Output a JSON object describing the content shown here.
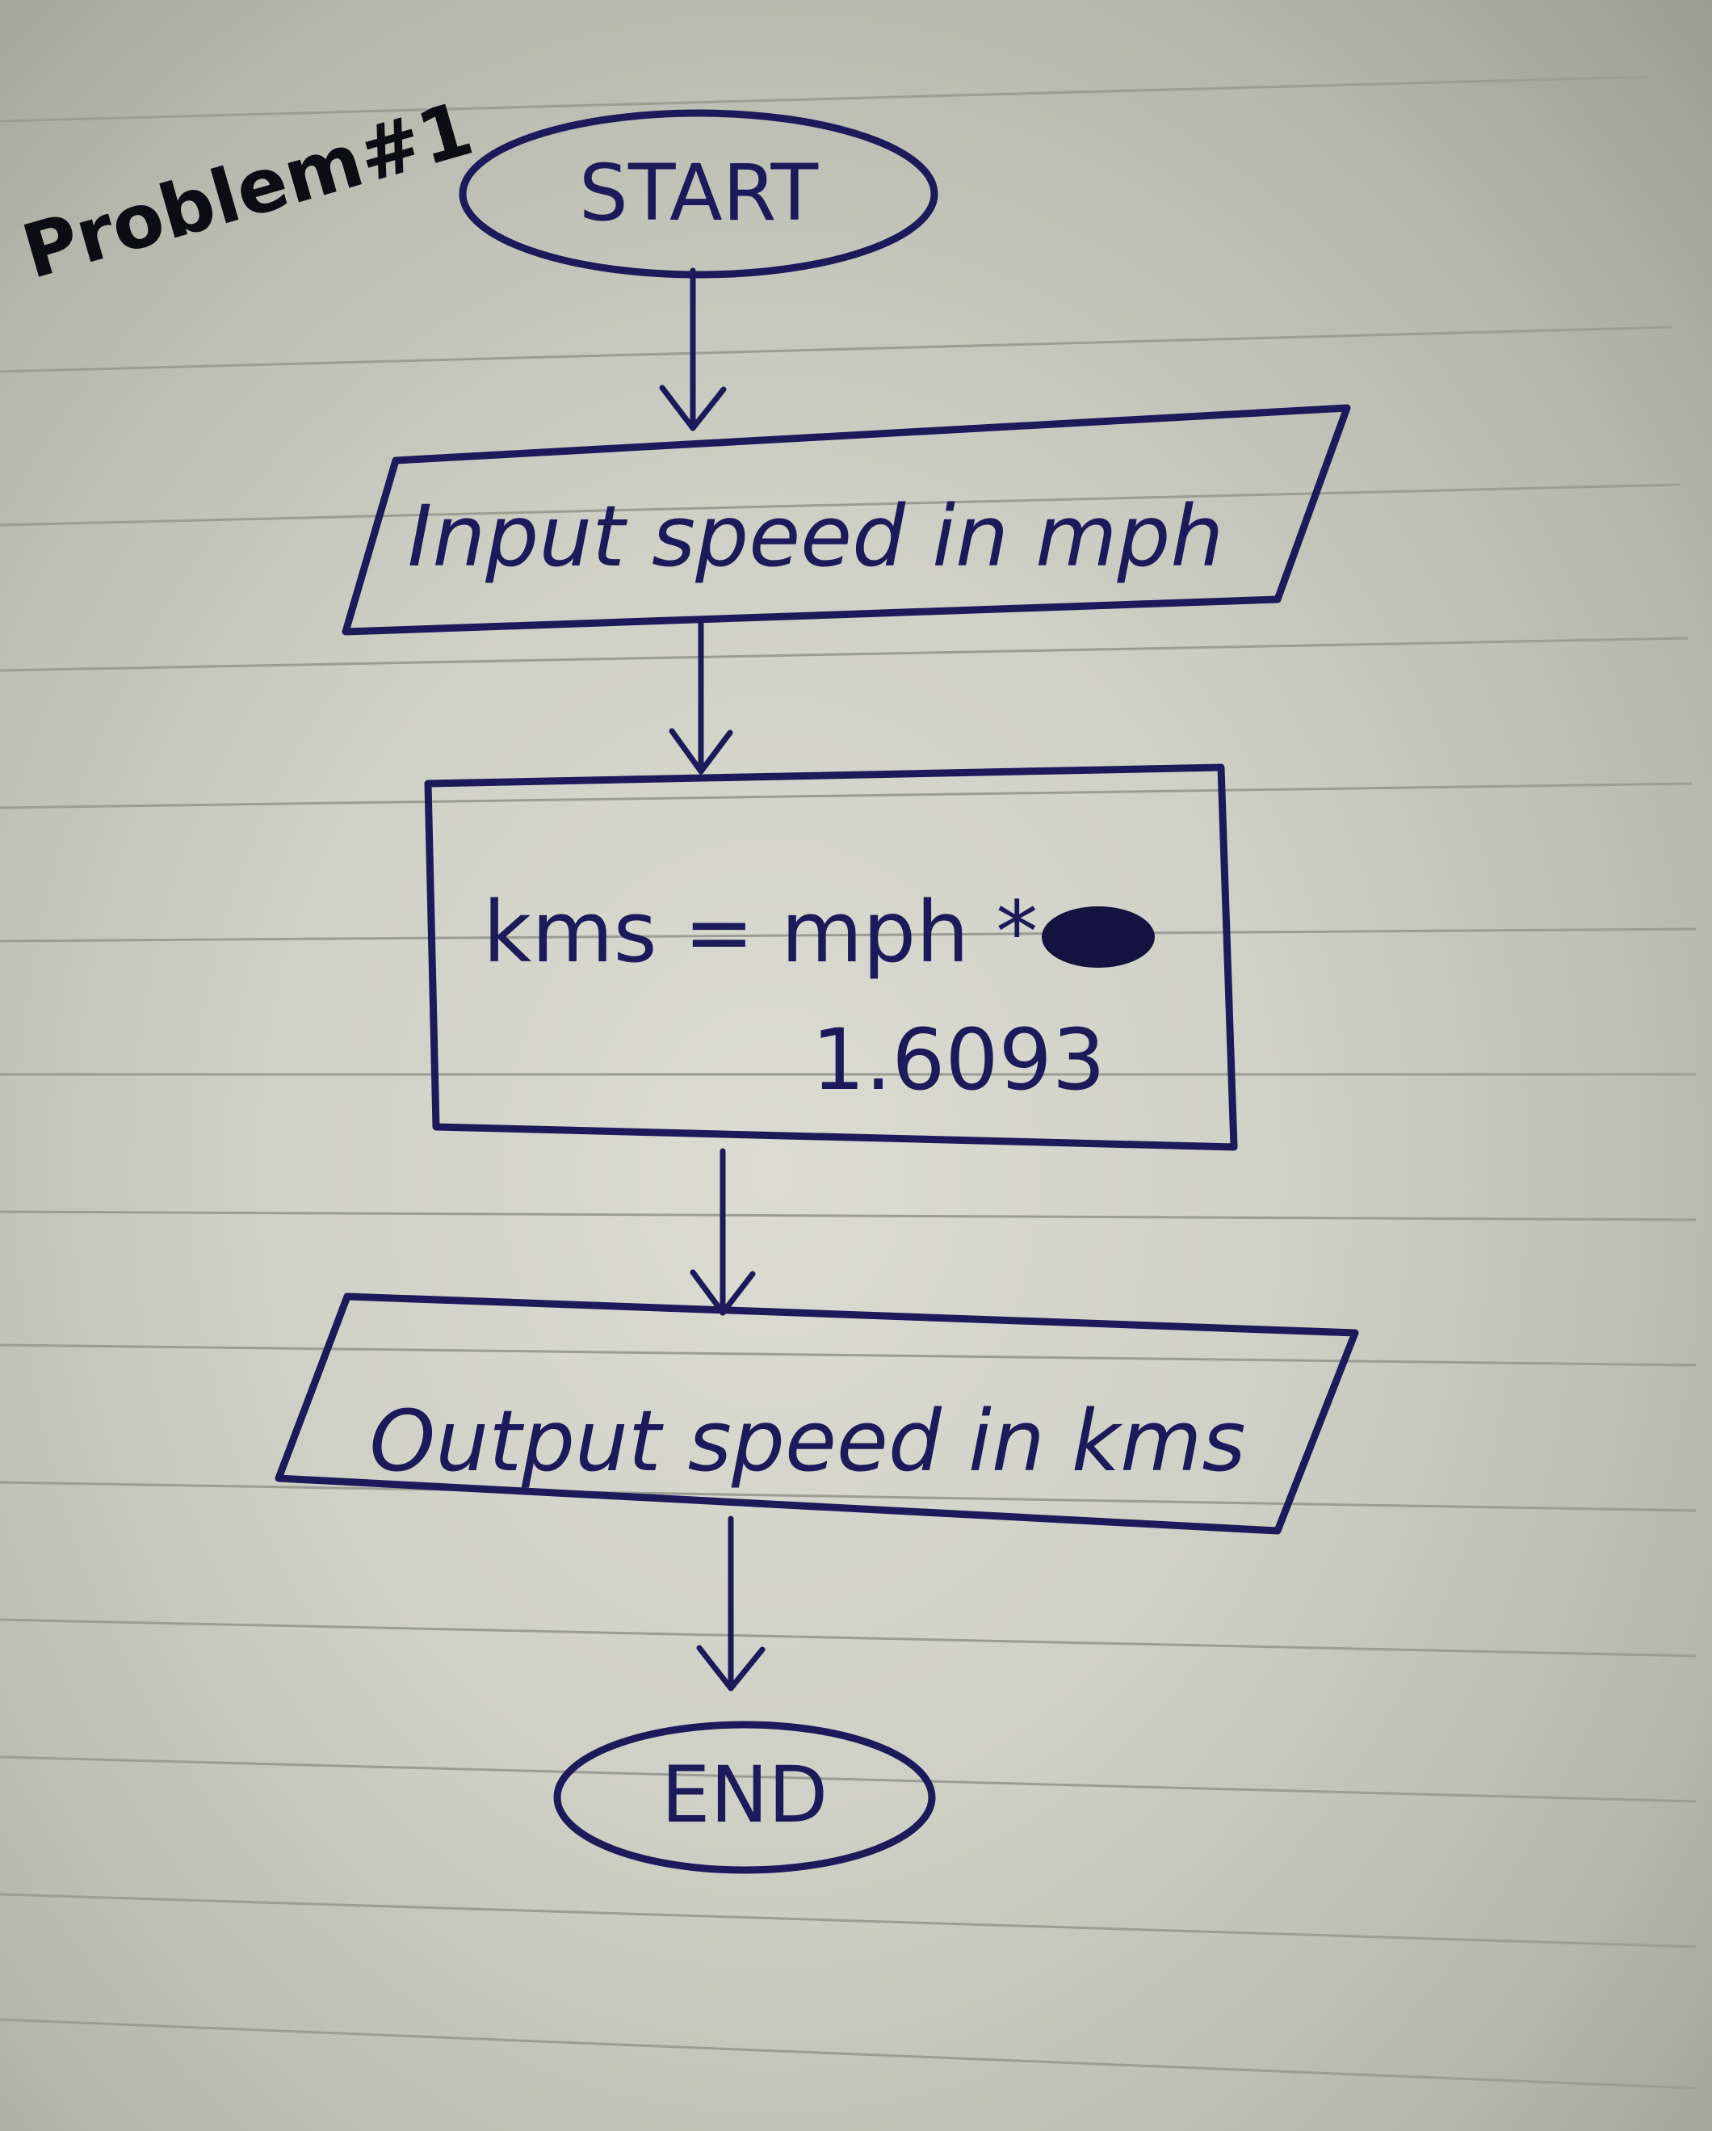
{
  "page_title": "Problem#1",
  "flowchart": {
    "start": "START",
    "input": "Input speed in mph",
    "process": {
      "line1": "kms = mph *",
      "line2": "1.6093"
    },
    "output": "Output speed in kms",
    "end": "END"
  },
  "colors": {
    "ink": "#1c1a5a",
    "title_ink": "#0c0c14",
    "paper": "#d6d6cc",
    "rule_lines": "#9b9c93"
  }
}
